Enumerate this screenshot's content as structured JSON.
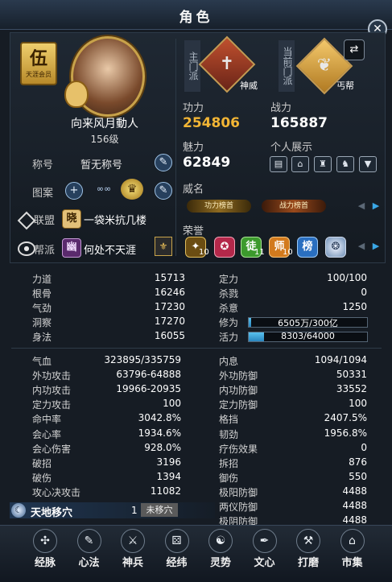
{
  "window": {
    "title": "角色",
    "close_glyph": "✕"
  },
  "profile": {
    "rank_char": "伍",
    "rank_sub": "天涯会员",
    "name": "向来风月動人",
    "level": "156级",
    "title_label": "称号",
    "title_value": "暂无称号",
    "pattern_label": "图案",
    "alliance_label": "联盟",
    "alliance_badge": "晓",
    "alliance_name": "一袋米抗几楼",
    "guild_label": "帮派",
    "guild_badge": "幽",
    "guild_name": "何处不天涯"
  },
  "sects": {
    "main_label": "主门派",
    "main_name": "神威",
    "current_label": "当前门派",
    "current_name": "丐帮"
  },
  "stats": {
    "gongli_label": "功力",
    "gongli_value": "254806",
    "zhanli_label": "战力",
    "zhanli_value": "165887",
    "meili_label": "魅力",
    "meili_value": "62849",
    "display_label": "个人展示",
    "weiming_label": "威名",
    "ribbon1": "功力榜首",
    "ribbon2": "战力榜首",
    "rongyu_label": "荣誉",
    "honor_counts": [
      "10",
      "11",
      "10"
    ]
  },
  "attributes_left": [
    {
      "label": "力道",
      "value": "15713"
    },
    {
      "label": "根骨",
      "value": "16246"
    },
    {
      "label": "气劲",
      "value": "17230"
    },
    {
      "label": "洞察",
      "value": "17270"
    },
    {
      "label": "身法",
      "value": "16055"
    }
  ],
  "attributes_right": [
    {
      "label": "定力",
      "value": "100/100"
    },
    {
      "label": "杀戮",
      "value": "0"
    },
    {
      "label": "杀意",
      "value": "1250"
    }
  ],
  "progress": {
    "xiuwei_label": "修为",
    "xiuwei_text": "6505万/300亿",
    "xiuwei_fraction": 0.0217,
    "huoli_label": "活力",
    "huoli_text": "8303/64000",
    "huoli_fraction": 0.13
  },
  "combat_left": [
    {
      "label": "气血",
      "value": "323895/335759"
    },
    {
      "label": "外功攻击",
      "value": "63796-64888"
    },
    {
      "label": "内功攻击",
      "value": "19966-20935"
    },
    {
      "label": "定力攻击",
      "value": "100"
    },
    {
      "label": "命中率",
      "value": "3042.8%"
    },
    {
      "label": "会心率",
      "value": "1934.6%"
    },
    {
      "label": "会心伤害",
      "value": "928.0%"
    },
    {
      "label": "破招",
      "value": "3196"
    },
    {
      "label": "破伤",
      "value": "1394"
    },
    {
      "label": "攻心决攻击",
      "value": "11082"
    }
  ],
  "combat_right": [
    {
      "label": "内息",
      "value": "1094/1094"
    },
    {
      "label": "外功防御",
      "value": "50331"
    },
    {
      "label": "内功防御",
      "value": "33552"
    },
    {
      "label": "定力防御",
      "value": "100"
    },
    {
      "label": "格挡",
      "value": "2407.5%"
    },
    {
      "label": "韧劲",
      "value": "1956.8%"
    },
    {
      "label": "疗伤效果",
      "value": "0"
    },
    {
      "label": "拆招",
      "value": "876"
    },
    {
      "label": "御伤",
      "value": "550"
    },
    {
      "label": "极阳防御",
      "value": "4488"
    },
    {
      "label": "两仪防御",
      "value": "4488"
    },
    {
      "label": "极阴防御",
      "value": "4488"
    }
  ],
  "tiandi": {
    "label": "天地移穴",
    "count": "1",
    "status": "未移穴"
  },
  "nav": [
    {
      "label": "经脉",
      "icon": "meridian-icon",
      "glyph": "✣"
    },
    {
      "label": "心法",
      "icon": "scroll-icon",
      "glyph": "✎"
    },
    {
      "label": "神兵",
      "icon": "sword-icon",
      "glyph": "⚔"
    },
    {
      "label": "经纬",
      "icon": "grid-icon",
      "glyph": "⚄"
    },
    {
      "label": "灵势",
      "icon": "spirit-icon",
      "glyph": "☯"
    },
    {
      "label": "文心",
      "icon": "brush-icon",
      "glyph": "✒"
    },
    {
      "label": "打磨",
      "icon": "hammer-icon",
      "glyph": "⚒"
    },
    {
      "label": "市集",
      "icon": "market-icon",
      "glyph": "⌂"
    }
  ],
  "colors": {
    "gold": "#f2b535",
    "white": "#ffffff",
    "accent_blue": "#3aa7e6"
  }
}
